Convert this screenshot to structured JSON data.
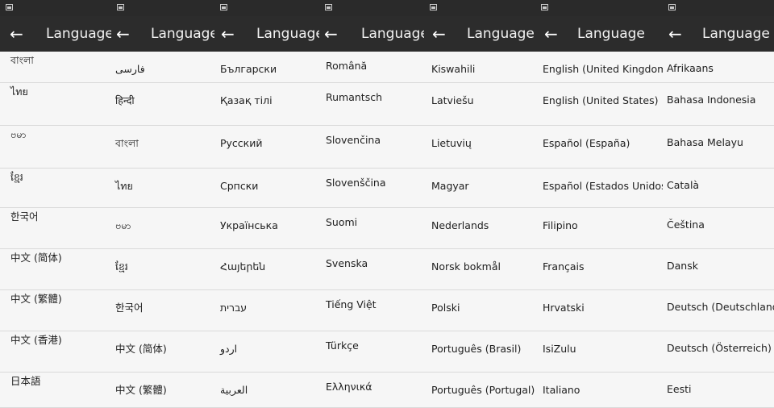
{
  "panels": [
    {
      "title": "Language",
      "back_glyph": "←",
      "items": [
        "বাংলা",
        "ไทย",
        "ဗမာ",
        "ខ្មែរ",
        "한국어",
        "中文 (简体)",
        "中文 (繁體)",
        "中文 (香港)",
        "日本語"
      ]
    },
    {
      "title": "Language",
      "back_glyph": "←",
      "items": [
        "فارسی",
        "हिन्दी",
        "বাংলা",
        "ไทย",
        "ဗမာ",
        "ខ្មែរ",
        "한국어",
        "中文 (简体)",
        "中文 (繁體)"
      ]
    },
    {
      "title": "Language",
      "back_glyph": "←",
      "items": [
        "Български",
        "Қазақ тілі",
        "Русский",
        "Српски",
        "Українська",
        "Հայերեն",
        "עברית",
        "اردو",
        "العربية"
      ]
    },
    {
      "title": "Language",
      "back_glyph": "←",
      "items": [
        "Română",
        "Rumantsch",
        "Slovenčina",
        "Slovenščina",
        "Suomi",
        "Svenska",
        "Tiếng Việt",
        "Türkçe",
        "Ελληνικά"
      ]
    },
    {
      "title": "Language",
      "back_glyph": "←",
      "items": [
        "Kiswahili",
        "Latviešu",
        "Lietuvių",
        "Magyar",
        "Nederlands",
        "Norsk bokmål",
        "Polski",
        "Português (Brasil)",
        "Português (Portugal)"
      ]
    },
    {
      "title": "Language",
      "back_glyph": "←",
      "items": [
        "English (United Kingdom)",
        "English (United States)",
        "Español (España)",
        "Español (Estados Unidos)",
        "Filipino",
        "Français",
        "Hrvatski",
        "IsiZulu",
        "Italiano"
      ]
    },
    {
      "title": "Language",
      "back_glyph": "←",
      "items": [
        "Afrikaans",
        "Bahasa Indonesia",
        "Bahasa Melayu",
        "Català",
        "Čeština",
        "Dansk",
        "Deutsch (Deutschland)",
        "Deutsch (Österreich)",
        "Eesti"
      ]
    }
  ]
}
